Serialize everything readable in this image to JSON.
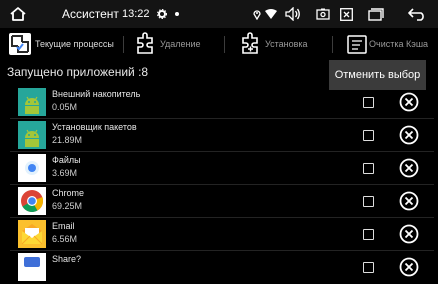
{
  "statusbar": {
    "home_icon": "home-icon",
    "title": "Ассистент",
    "time": "13:22",
    "icons": [
      "settings-icon",
      "location-icon",
      "wifi-icon",
      "volume-icon",
      "screenshot-icon",
      "close-box-icon",
      "window-icon",
      "back-icon"
    ]
  },
  "tabs": [
    {
      "label": "Текущие процессы",
      "icon": "running-processes-icon",
      "active": true
    },
    {
      "label": "Удаление",
      "icon": "uninstall-icon",
      "active": false
    },
    {
      "label": "Установка",
      "icon": "install-icon",
      "active": false
    },
    {
      "label": "Очистка Кэша",
      "icon": "clear-cache-icon",
      "active": false
    }
  ],
  "header": {
    "running_label": "Запущено приложений :8"
  },
  "menu": {
    "deselect_label": "Отменить выбор"
  },
  "apps": [
    {
      "name": "Внешний накопитель",
      "size": "0.05M",
      "icon": "android-icon"
    },
    {
      "name": "Установщик пакетов",
      "size": "21.89M",
      "icon": "android-icon"
    },
    {
      "name": "Файлы",
      "size": "3.69M",
      "icon": "files-icon"
    },
    {
      "name": "Chrome",
      "size": "69.25M",
      "icon": "chrome-icon"
    },
    {
      "name": "Email",
      "size": "6.56M",
      "icon": "email-icon"
    },
    {
      "name": "Share?",
      "size": "",
      "icon": "app-icon"
    }
  ],
  "colors": {
    "android_bg": "#26a69a",
    "android_green": "#a4c639",
    "accent_blue": "#4285f4"
  }
}
